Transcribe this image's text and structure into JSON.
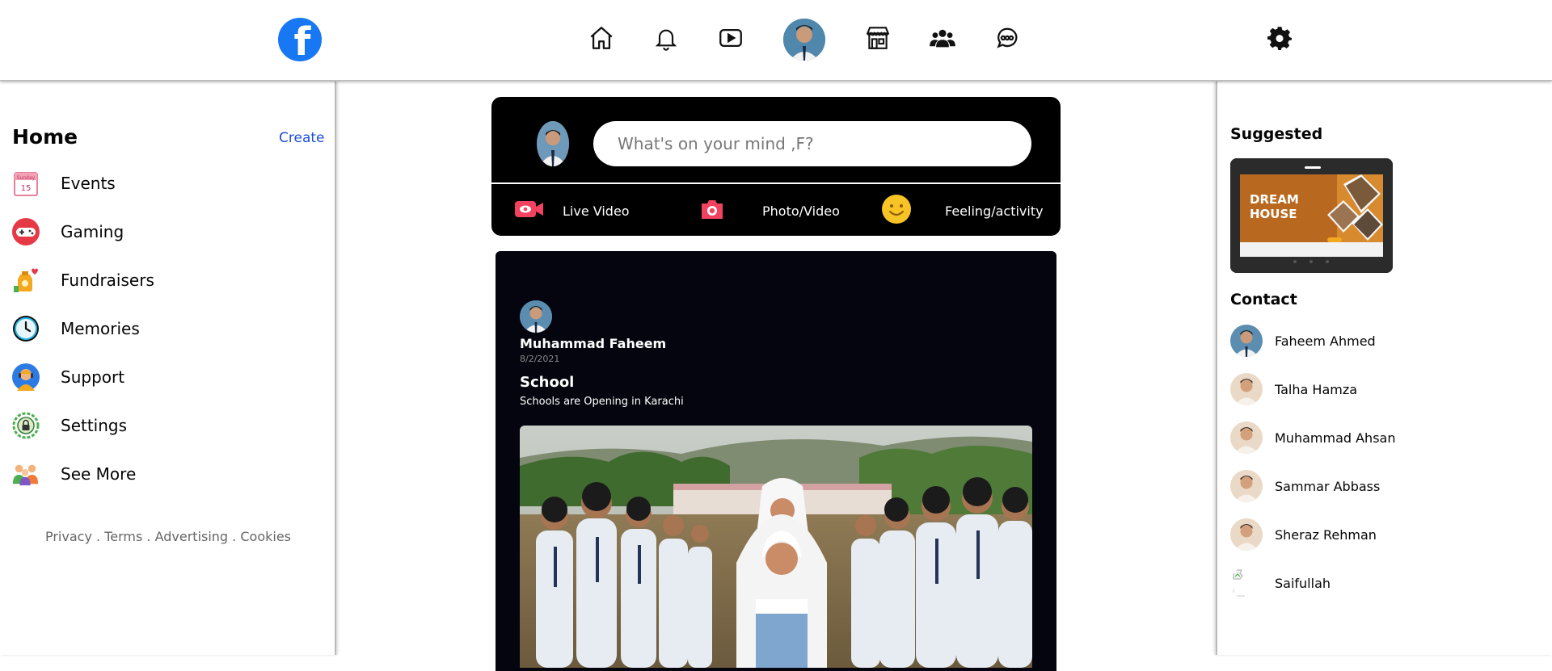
{
  "header": {
    "logo_icon": "facebook-logo-icon",
    "logo_letter": "f",
    "nav_icons": [
      "home-icon",
      "bell-icon",
      "video-icon",
      "profile-avatar",
      "store-icon",
      "groups-icon",
      "messenger-icon"
    ],
    "settings_icon": "gear-icon"
  },
  "left_sidebar": {
    "heading": "Home",
    "create_label": "Create",
    "items": [
      {
        "label": "Events",
        "icon": "calendar-icon"
      },
      {
        "label": "Gaming",
        "icon": "game-controller-icon"
      },
      {
        "label": "Fundraisers",
        "icon": "fundraiser-icon"
      },
      {
        "label": "Memories",
        "icon": "clock-icon"
      },
      {
        "label": "Support",
        "icon": "support-icon"
      },
      {
        "label": "Settings",
        "icon": "settings-lock-icon"
      },
      {
        "label": "See More",
        "icon": "people-icon"
      }
    ],
    "footer": [
      "Privacy",
      "Terms",
      "Advertising",
      "Cookies"
    ],
    "footer_separator": " . "
  },
  "composer": {
    "placeholder": "What's on your mind ,F?",
    "actions": [
      {
        "label": "Live Video",
        "icon": "live-video-icon"
      },
      {
        "label": "Photo/Video",
        "icon": "camera-icon"
      },
      {
        "label": "Feeling/activity",
        "icon": "smiley-icon"
      }
    ]
  },
  "post": {
    "author": "Muhammad Faheem",
    "date": "8/2/2021",
    "title": "School",
    "body": "Schools are Opening in Karachi"
  },
  "right_sidebar": {
    "suggested_title": "Suggested",
    "suggested_ad": {
      "line1": "DREAM",
      "line2": "HOUSE"
    },
    "contact_title": "Contact",
    "contacts": [
      "Faheem Ahmed",
      "Talha Hamza",
      "Muhammad Ahsan",
      "Sammar Abbass",
      "Sheraz Rehman",
      "Saifullah"
    ]
  },
  "colors": {
    "brand": "#1877f2",
    "panel_dark": "#000000",
    "link": "#1a4fd6"
  }
}
